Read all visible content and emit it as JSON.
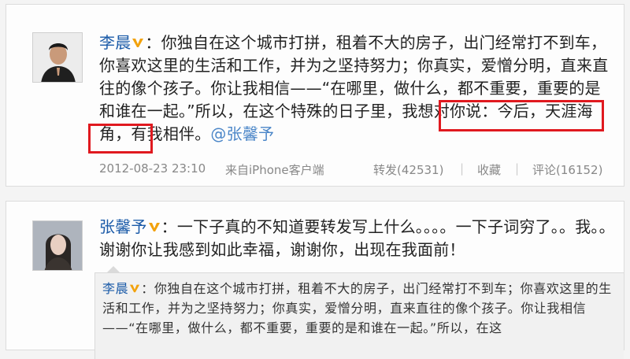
{
  "post1": {
    "author": "李晨",
    "badge_suffix": "：",
    "text_before": "你独自在这个城市打拼，租着不大的房子，出门经常打不到车，你喜欢这里的生活和工作，并为之坚持努力；你真实，爱憎分明，直来直往的像个孩子。你让我相信——“在哪里，做什么，都不重要，重要的是和谁在一起。”所以，在这个特殊的日子里，我想对你说：",
    "text_highlight1": "今后，天涯海角，有我",
    "text_highlight2": "相伴。",
    "mention": "@张馨予",
    "timestamp": "2012-08-23 23:10",
    "source": "来自iPhone客户端",
    "repost_label": "转发(42531)",
    "favorite_label": "收藏",
    "comment_label": "评论(16152)",
    "separator": "|"
  },
  "post2": {
    "author": "张馨予",
    "badge_suffix": "：",
    "text": "一下子真的不知道要转发写上什么。。。。一下子词穷了。。我。。谢谢你让我感到如此幸福，谢谢你，出现在我面前！",
    "quote": {
      "author": "李晨",
      "badge_suffix": "：",
      "text": "你独自在这个城市打拼，租着不大的房子，出门经常打不到车；你喜欢这里的生活和工作，并为之坚持努力；你真实，爱憎分明，直来直往的像个孩子。你让我相信——“在哪里，做什么，都不重要，重要的是和谁在一起。”所以，在这"
    }
  },
  "colors": {
    "author": "#1a5aa8",
    "highlight_border": "#e0191f",
    "meta_text": "#888888",
    "verified_badge": "#f2a20c"
  },
  "icons": {
    "verified": "verified-v-icon"
  }
}
